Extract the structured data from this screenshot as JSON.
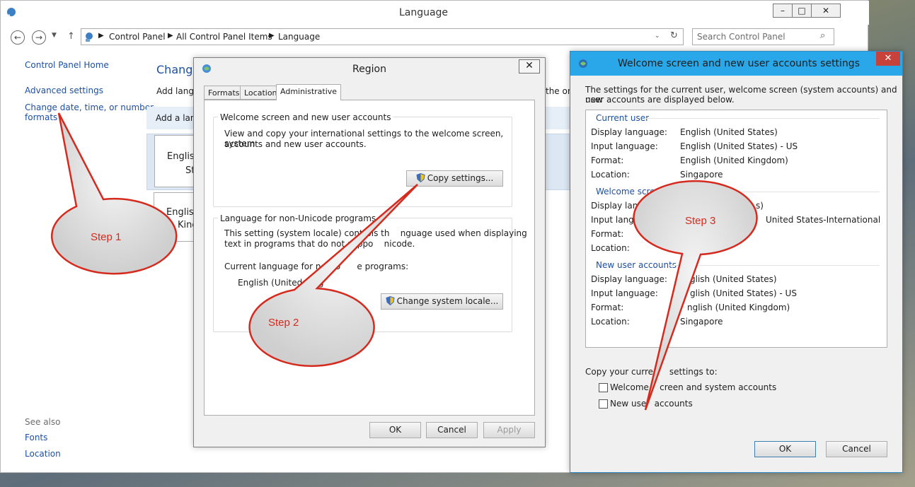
{
  "language_window": {
    "title": "Language",
    "breadcrumb": [
      "Control Panel",
      "All Control Panel Items",
      "Language"
    ],
    "search_placeholder": "Search Control Panel",
    "sidebar": {
      "home": "Control Panel Home",
      "advanced": "Advanced settings",
      "change_date_line1": "Change date, time, or number",
      "change_date_line2": "formats",
      "see_also": "See also",
      "fonts": "Fonts",
      "location": "Location"
    },
    "main": {
      "heading": "Change",
      "add_lang_text": "Add langu",
      "add_lang_button": "Add a lang",
      "item1_line1": "English",
      "item1_line2": "Sta",
      "item2_line1": "English",
      "item2_line2": "King",
      "trailing_text": "the on"
    }
  },
  "region_dialog": {
    "title": "Region",
    "tabs": [
      "Formats",
      "Location",
      "Administrative"
    ],
    "group1_title": "Welcome screen and new user accounts",
    "group1_text_line1": "View and copy your international settings to the welcome screen, system",
    "group1_text_line2": "accounts and new user accounts.",
    "copy_button": "Copy settings...",
    "group2_title": "Language for non-Unicode programs",
    "group2_text_line1": "This setting (system locale) controls th    nguage used when displaying",
    "group2_text_line2": "text in programs that do not suppo    nicode.",
    "current_label": "Current language for non-U      e programs:",
    "current_value": "English (United King",
    "change_locale_button": "Change system locale...",
    "ok": "OK",
    "cancel": "Cancel",
    "apply": "Apply"
  },
  "welcome_dialog": {
    "title": "Welcome screen and new user accounts settings",
    "intro_line1": "The settings for the current user, welcome screen (system accounts) and new",
    "intro_line2": "user accounts are displayed below.",
    "sections": [
      {
        "name": "Current user",
        "rows": [
          {
            "label": "Display language:",
            "value": "English (United States)"
          },
          {
            "label": "Input language:",
            "value": "English (United States) - US"
          },
          {
            "label": "Format:",
            "value": "English (United Kingdom)"
          },
          {
            "label": "Location:",
            "value": "Singapore"
          }
        ]
      },
      {
        "name": "Welcome screen",
        "rows": [
          {
            "label": "Display langua",
            "value": "s)"
          },
          {
            "label": "Input languag",
            "value": "United States-International"
          },
          {
            "label": "Format:",
            "value": ""
          },
          {
            "label": "Location:",
            "value": ""
          }
        ]
      },
      {
        "name": "New user accounts",
        "rows": [
          {
            "label": "Display language:",
            "value": "glish (United States)"
          },
          {
            "label": "Input language:",
            "value": "glish (United States) - US"
          },
          {
            "label": "Format:",
            "value": "nglish (United Kingdom)"
          },
          {
            "label": "Location:",
            "value": "Singapore"
          }
        ]
      }
    ],
    "copy_label": "Copy your curren    settings to:",
    "check1": "Welcome    creen and system accounts",
    "check2": "New use   accounts",
    "ok": "OK",
    "cancel": "Cancel"
  },
  "callouts": {
    "step1": "Step 1",
    "step2": "Step 2",
    "step3": "Step 3",
    "color": "#d42b1e"
  }
}
